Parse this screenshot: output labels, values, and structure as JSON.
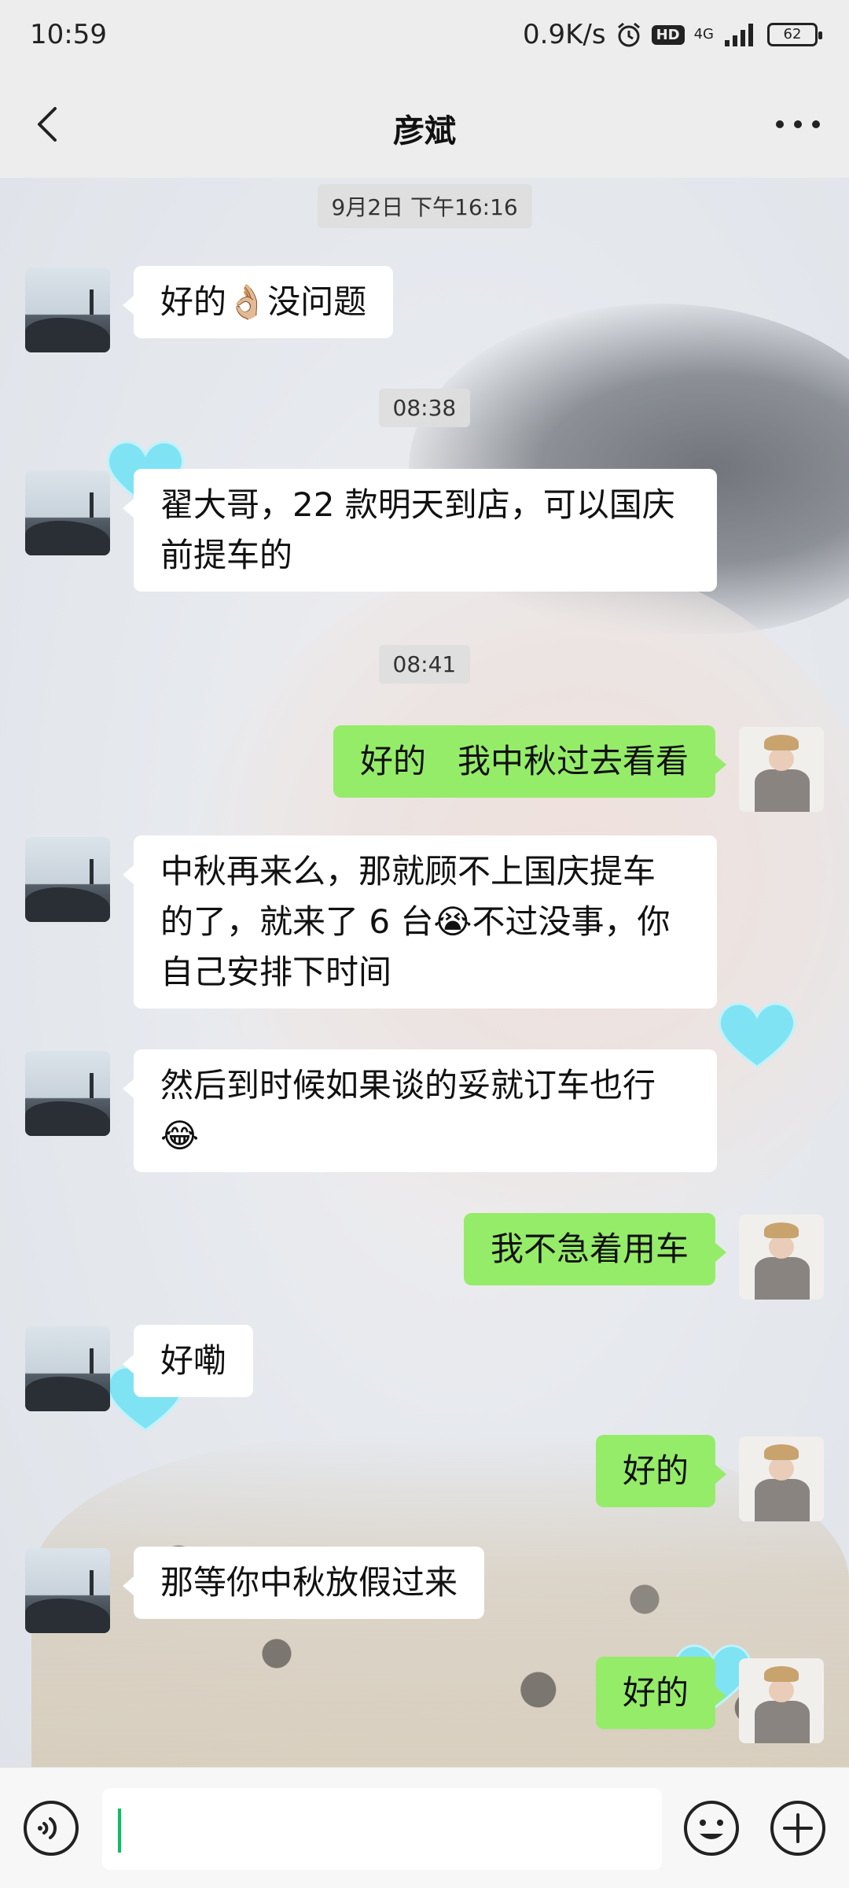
{
  "status_bar": {
    "time": "10:59",
    "net_speed": "0.9K/s",
    "hd": "HD",
    "network": "4G",
    "battery": "62"
  },
  "header": {
    "title": "彦斌"
  },
  "messages": [
    {
      "type": "time",
      "text": "9月2日 下午16:16"
    },
    {
      "type": "msg",
      "side": "in",
      "lines": [
        "好的👌🏼没问题"
      ]
    },
    {
      "type": "time",
      "text": "08:38"
    },
    {
      "type": "msg",
      "side": "in",
      "lines": [
        "翟大哥，22 款明天到店，可以国庆",
        "前提车的"
      ]
    },
    {
      "type": "time",
      "text": "08:41"
    },
    {
      "type": "msg",
      "side": "out",
      "lines": [
        "好的   我中秋过去看看"
      ]
    },
    {
      "type": "msg",
      "side": "in",
      "lines": [
        "中秋再来么，那就顾不上国庆提车",
        "的了，就来了 6 台😭不过没事，你",
        "自己安排下时间"
      ]
    },
    {
      "type": "msg",
      "side": "in",
      "lines": [
        "然后到时候如果谈的妥就订车也行",
        "😂"
      ]
    },
    {
      "type": "msg",
      "side": "out",
      "lines": [
        "我不急着用车"
      ]
    },
    {
      "type": "msg",
      "side": "in",
      "lines": [
        "好嘞"
      ]
    },
    {
      "type": "msg",
      "side": "out",
      "lines": [
        "好的"
      ]
    },
    {
      "type": "msg",
      "side": "in",
      "lines": [
        "那等你中秋放假过来"
      ]
    },
    {
      "type": "msg",
      "side": "out",
      "lines": [
        "好的"
      ]
    }
  ],
  "colors": {
    "outgoing_bubble": "#95ec69",
    "incoming_bubble": "#ffffff",
    "cursor": "#07c160"
  },
  "icons": {
    "back": "chevron-left-icon",
    "more": "more-dots-icon",
    "voice": "voice-icon",
    "emoji": "emoji-icon",
    "plus": "plus-icon"
  }
}
